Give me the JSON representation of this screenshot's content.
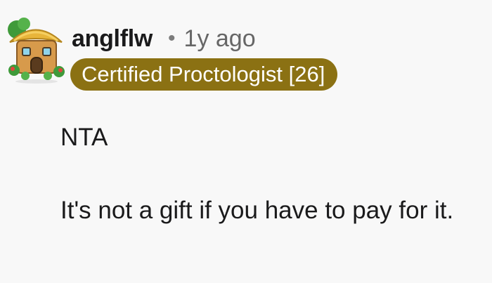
{
  "comment": {
    "author": "anglflw",
    "separator": "•",
    "time_ago": "1y ago",
    "flair": "Certified Proctologist [26]",
    "colors": {
      "flair_background": "#8b7113",
      "flair_text": "#ffffff",
      "background": "#f8f8f8"
    },
    "avatar_icon": "snoo-avatar-house-icon",
    "paragraphs": [
      "NTA",
      "It's not a gift if you have to pay for it."
    ]
  }
}
